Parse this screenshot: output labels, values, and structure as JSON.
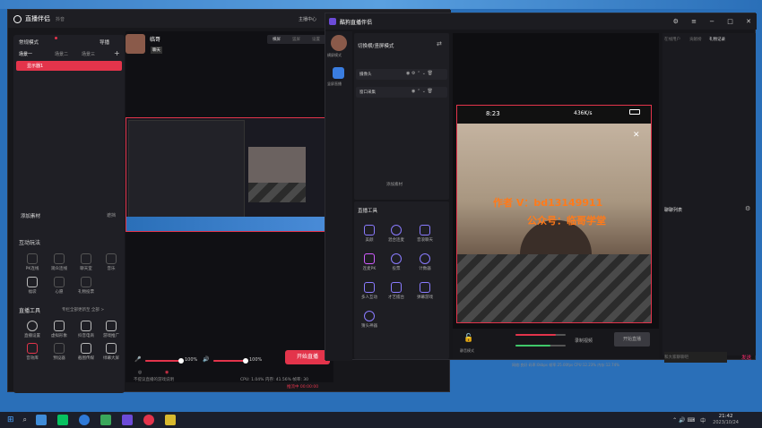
{
  "left_window": {
    "app_title": "直播伴侣",
    "app_sub": "抖音",
    "header_links": [
      "主播中心"
    ],
    "mode_label": "常规模式",
    "import_label": "导播",
    "scene_tabs": [
      "场景一",
      "场景二",
      "场景三"
    ],
    "scene_item": "显示器1",
    "add_material": "添加素材",
    "settings_small": "遮挡",
    "interactive_title": "互动玩法",
    "interactive_items": [
      "PK连线",
      "观众连线",
      "聊天室",
      "音乐",
      "福袋",
      "心愿",
      "礼物投票"
    ],
    "tools_title": "直播工具",
    "tools_hint": "专栏全部更新至 全部 >",
    "tools_items": [
      "直播设置",
      "虚拟形象",
      "抖音电商",
      "游戏推广",
      "音效库",
      "预设器",
      "截图传媒",
      "绿幕大屏"
    ],
    "user_name": "临哥",
    "user_tag": "聊天",
    "preview_tabs": [
      "横屏",
      "竖屏",
      "设置"
    ],
    "volume_pct": "100%",
    "volume_pct2": "100%",
    "start_live": "开始直播",
    "status_text": "CPU: 1.04%  内存: 41.56%  帧率: 30",
    "status_red": "推流中 00:00:00",
    "footer_note": "不提议直播的游戏说明"
  },
  "right_window": {
    "app_title": "酷狗直播伴侣",
    "left_nav": [
      "横屏模式",
      "竖屏直播"
    ],
    "switch_label": "切换横/竖屏模式",
    "sources": [
      "摄像头",
      "窗口采集"
    ],
    "add_source": "添加素材",
    "tools_title": "直播工具",
    "tools": [
      "美颜",
      "混合连麦",
      "音浪聊天",
      "连麦PK",
      "投票",
      "计数器",
      "多人互动",
      "才艺擂台",
      "弹幕游戏",
      "猜头神器"
    ],
    "phone_status": {
      "time": "8:23",
      "net": "436K/s"
    },
    "watermark_line1": "作者 V：bd13149911",
    "watermark_line2": "公众号：临哥学堂",
    "right_tabs": [
      "在线用户",
      "贡献榜",
      "礼物记录"
    ],
    "chat_list_title": "聊聊列表",
    "chat_placeholder": "和大家聊聊吧",
    "send_label": "发送",
    "mic_label": "静音模式",
    "record_label": "录制视频",
    "start_live": "开始直播",
    "bottom_status": "网络:良好  码率:0kbps  帧率:25.00fps  CPU:12.23%  内存:12.74%"
  },
  "taskbar": {
    "time": "21:42",
    "date": "2023/10/24",
    "lang": "中"
  },
  "colors": {
    "accent_red": "#e3344b",
    "accent_pink": "#ff2d6f",
    "watermark": "#ff7a1a"
  }
}
